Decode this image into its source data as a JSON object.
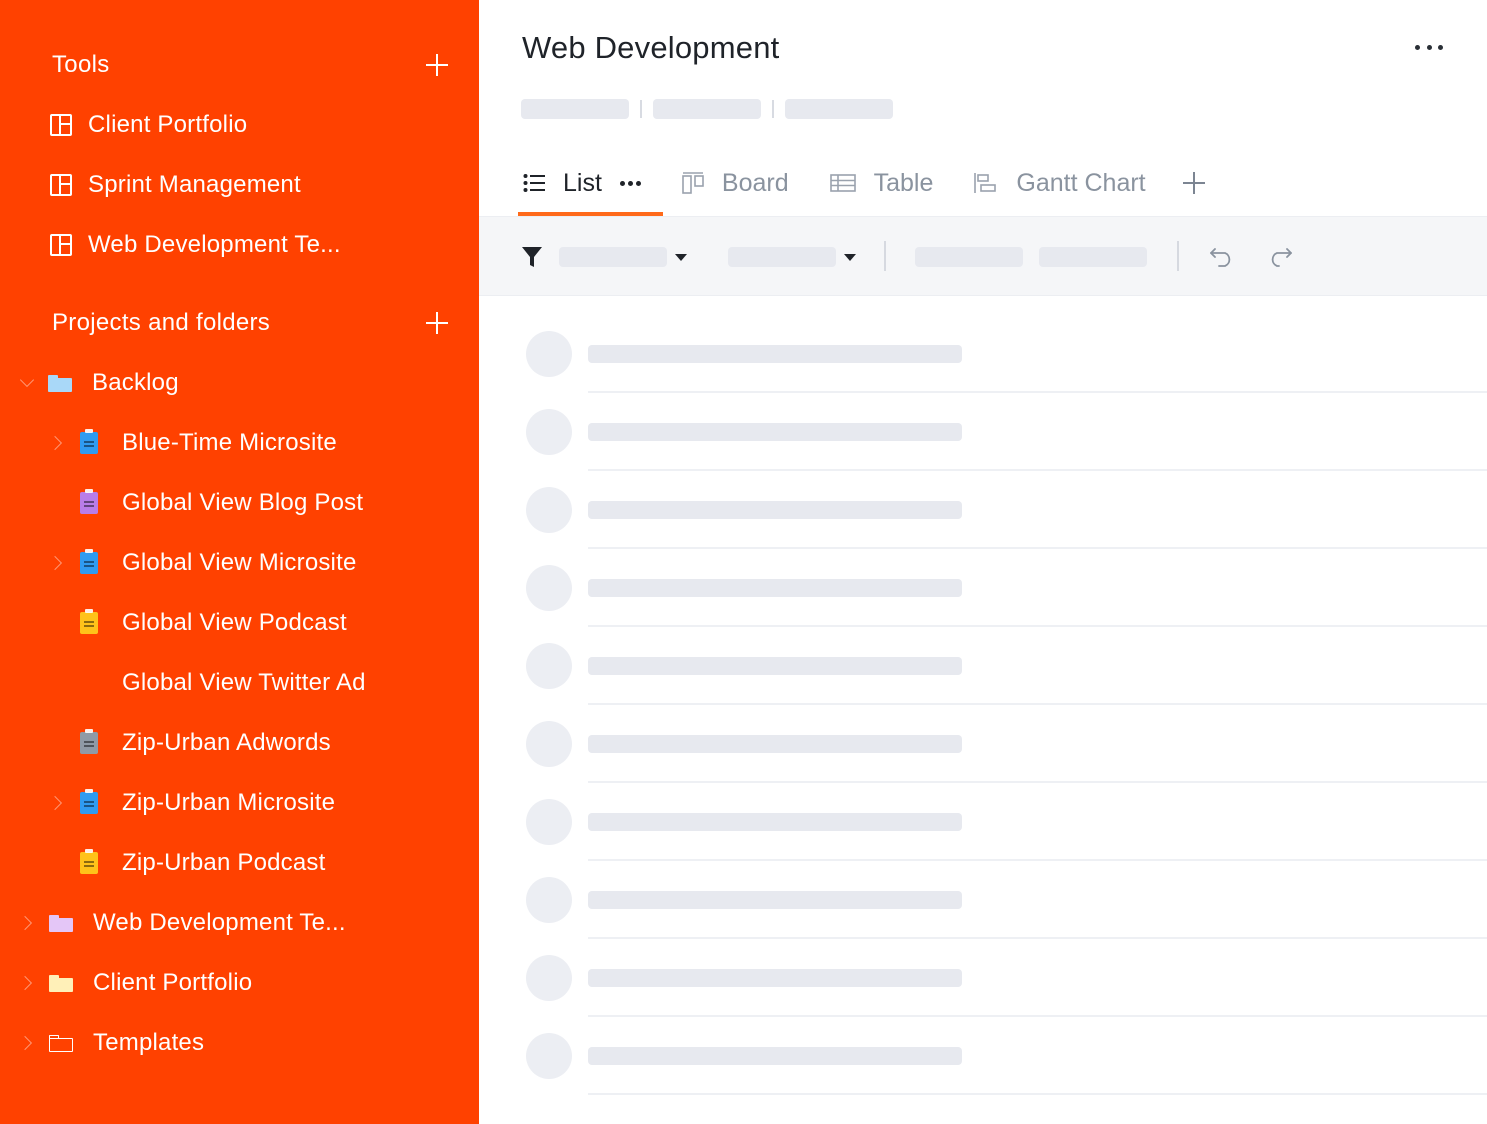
{
  "sidebar": {
    "bg_color": "#ff4100",
    "tools": {
      "title": "Tools",
      "items": [
        {
          "label": "Client Portfolio",
          "icon": "board-icon"
        },
        {
          "label": "Sprint Management",
          "icon": "board-icon"
        },
        {
          "label": "Web Development Te...",
          "icon": "board-icon"
        }
      ]
    },
    "projects": {
      "title": "Projects and folders",
      "backlog": {
        "label": "Backlog",
        "icon": "folder-icon",
        "color": "#a9d8f8"
      },
      "children": [
        {
          "label": "Blue-Time Microsite",
          "icon": "clipboard-icon",
          "color": "#2f9bf0",
          "expandable": true
        },
        {
          "label": "Global View Blog Post",
          "icon": "clipboard-icon",
          "color": "#b97de8",
          "expandable": false
        },
        {
          "label": "Global View Microsite",
          "icon": "clipboard-icon",
          "color": "#2f9bf0",
          "expandable": true
        },
        {
          "label": "Global View Podcast",
          "icon": "clipboard-icon",
          "color": "#ffc21a",
          "expandable": false
        },
        {
          "label": "Global View Twitter Ad",
          "icon": "",
          "color": "",
          "expandable": false
        },
        {
          "label": "Zip-Urban Adwords",
          "icon": "clipboard-icon",
          "color": "#8f9aa6",
          "expandable": false
        },
        {
          "label": "Zip-Urban Microsite",
          "icon": "clipboard-icon",
          "color": "#2f9bf0",
          "expandable": true
        },
        {
          "label": "Zip-Urban Podcast",
          "icon": "clipboard-icon",
          "color": "#ffc21a",
          "expandable": false
        }
      ],
      "folders": [
        {
          "label": "Web Development Te...",
          "icon": "folder-icon",
          "color": "#e4c6f7"
        },
        {
          "label": "Client Portfolio",
          "icon": "folder-icon",
          "color": "#fff0b8"
        },
        {
          "label": "Templates",
          "icon": "folder-outline-icon",
          "color": "#ffffff"
        }
      ]
    }
  },
  "main": {
    "title": "Web Development",
    "tabs": [
      {
        "label": "List",
        "icon": "list-icon",
        "active": true
      },
      {
        "label": "Board",
        "icon": "board-view-icon",
        "active": false
      },
      {
        "label": "Table",
        "icon": "table-icon",
        "active": false
      },
      {
        "label": "Gantt Chart",
        "icon": "gantt-icon",
        "active": false
      }
    ],
    "accent_color": "#ff6a1a",
    "skeleton_rows": 10
  }
}
